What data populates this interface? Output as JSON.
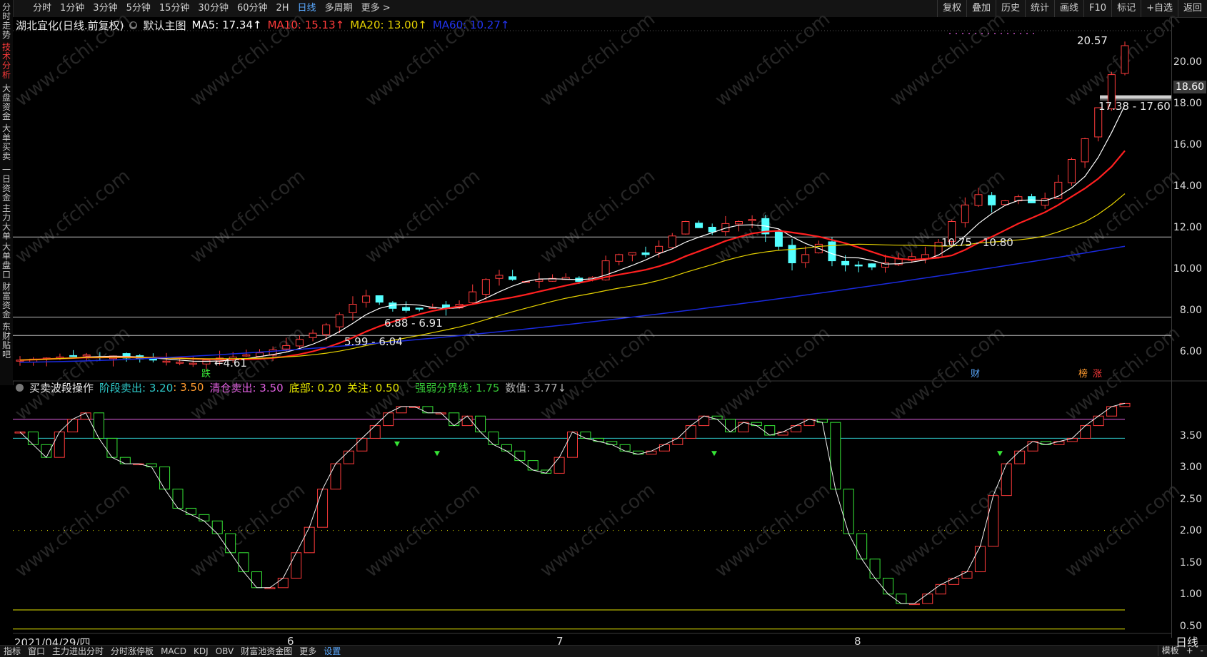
{
  "toolbar": {
    "periods": [
      "分时",
      "1分钟",
      "3分钟",
      "5分钟",
      "15分钟",
      "30分钟",
      "60分钟",
      "2H",
      "日线",
      "多周期",
      "更多 >"
    ],
    "active_period": "日线",
    "tools": [
      "复权",
      "叠加",
      "历史",
      "统计",
      "画线",
      "F10",
      "标记",
      "+自选",
      "返回"
    ]
  },
  "left_tabs": [
    "分时走势",
    "技术分析",
    "大盘资金",
    "大单买卖",
    "一日资金",
    "主力大单",
    "大单盘口",
    "财富资金",
    "东财贴吧"
  ],
  "legend_main": {
    "stock": "湖北宜化(日线.前复权)",
    "template": "默认主图",
    "ma5": "MA5: 17.34↑",
    "ma10": "MA10: 15.13↑",
    "ma20": "MA20: 13.00↑",
    "ma60": "MA60: 10.27↑"
  },
  "legend_sub": {
    "name": "买卖波段操作",
    "stage_sell": "阶段卖出: 3.20",
    "stage_sell_val2": ": 3.50",
    "clear_sell": "清仓卖出: 3.50",
    "bottom": "底部: 0.20",
    "watch": "关注: 0.50",
    "strength": "强弱分界线: 1.75",
    "value": "数值: 3.77↓"
  },
  "colors": {
    "up": "#ff3b3b",
    "down": "#54ffff",
    "ma5": "#ffffff",
    "ma10": "#ff2020",
    "ma20": "#e6d200",
    "ma60": "#1a2adf",
    "magenta": "#e060e0",
    "cyan": "#2ec8c8",
    "yellow": "#e6e600",
    "green": "#36e636"
  },
  "main_axis": {
    "ticks": [
      "20.00",
      "18.00",
      "16.00",
      "14.00",
      "12.00",
      "10.00",
      "8.00",
      "6.00"
    ],
    "current_price": "18.60"
  },
  "sub_axis": {
    "ticks": [
      "3.50",
      "3.00",
      "2.50",
      "2.00",
      "1.50",
      "1.00",
      "0.50"
    ]
  },
  "annotations": {
    "high": "20.57",
    "low": "←4.61",
    "gap1": "17.38 - 17.60",
    "gap2": "10.75 - 10.80",
    "gap3": "6.88 - 6.91",
    "gap4": "5.99 - 6.04",
    "tag_die": "跌",
    "tag_cai": "财",
    "tag_bang": "榜",
    "tag_zhang": "涨"
  },
  "x_axis": {
    "start_date": "2021/04/29/四",
    "months": [
      "6",
      "7",
      "8"
    ]
  },
  "bottom_tabs": [
    "指标",
    "窗口",
    "主力进出分时",
    "分时涨停板",
    "MACD",
    "KDJ",
    "OBV",
    "财富池资金图",
    "更多",
    "设置"
  ],
  "active_bottom_tab": "设置",
  "bottom_right": {
    "template": "模板",
    "plus": "+",
    "minus": "-",
    "period": "日线"
  },
  "watermark": "www.cfchi.com"
}
